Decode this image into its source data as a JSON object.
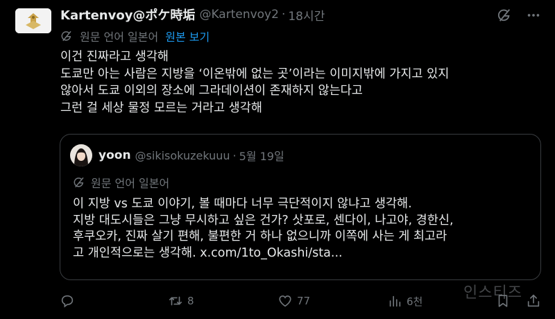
{
  "tweet": {
    "display_name": "Kartenvoy@ポケ時垢",
    "handle": "@Kartenvoy2",
    "separator": "·",
    "time": "18시간",
    "translation": {
      "source_language": "원문 언어 일본어",
      "show_original": "원본 보기"
    },
    "text_lines": [
      "이건 진짜라고 생각해",
      "도쿄만 아는 사람은 지방을 ‘이온밖에 없는 곳’이라는 이미지밖에 가지고 있지",
      "않아서 도쿄 이외의 장소에 그라데이션이 존재하지 않는다고",
      "그런 걸 세상 물정 모르는 거라고 생각해"
    ]
  },
  "quote": {
    "display_name": "yoon",
    "handle": "@sikisokuzekuuu",
    "separator": "·",
    "date": "5월 19일",
    "translation": {
      "source_language": "원문 언어 일본어"
    },
    "text_lines": [
      "이 지방 vs 도쿄 이야기, 볼 때마다 너무 극단적이지 않냐고 생각해.",
      "지방 대도시들은 그냥 무시하고 싶은 건가? 삿포로, 센다이, 나고야, 경한신,",
      "후쿠오카, 진짜 살기 편해, 불편한 거 하나 없으니까 이쪽에 사는 게 최고라",
      "고 개인적으로는 생각해. x.com/1to_Okashi/sta..."
    ]
  },
  "actions": {
    "reply_count": "",
    "retweet_count": "8",
    "like_count": "77",
    "views_count": "6천"
  },
  "watermark": "인스티즈",
  "icons": {
    "grok": "grok-icon",
    "more": "more-icon",
    "translate": "translate-icon",
    "reply": "reply-icon",
    "retweet": "retweet-icon",
    "like": "heart-icon",
    "views": "views-icon",
    "bookmark": "bookmark-icon",
    "share": "share-icon"
  },
  "colors": {
    "background": "#000000",
    "text": "#e7e9ea",
    "muted": "#71767b",
    "link": "#1d9bf0",
    "border": "#3a3d41"
  }
}
